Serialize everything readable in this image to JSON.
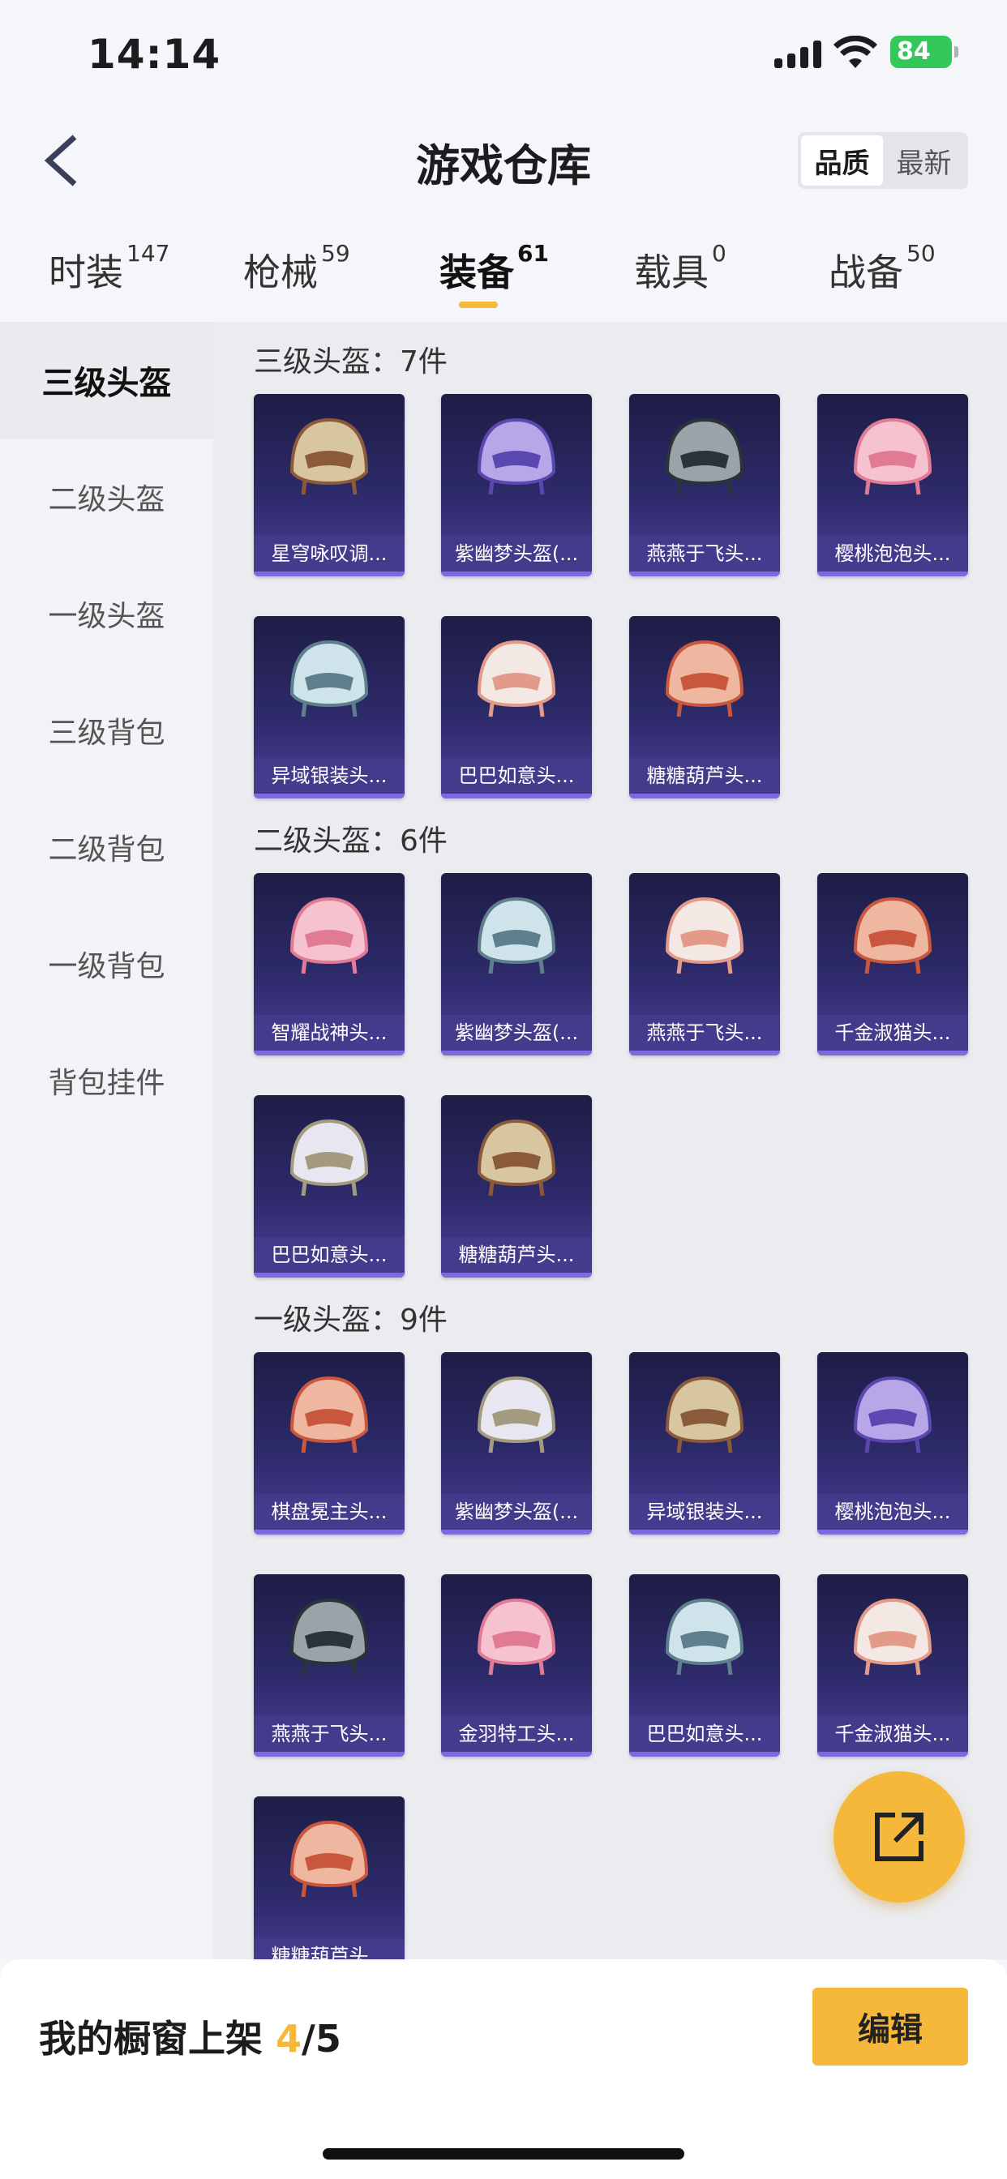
{
  "status": {
    "time": "14:14",
    "battery": "84"
  },
  "header": {
    "title": "游戏仓库",
    "sort_options": [
      "品质",
      "最新"
    ],
    "sort_active": 0
  },
  "tabs": [
    {
      "label": "时装",
      "count": "147"
    },
    {
      "label": "枪械",
      "count": "59"
    },
    {
      "label": "装备",
      "count": "61"
    },
    {
      "label": "载具",
      "count": "0"
    },
    {
      "label": "战备",
      "count": "50"
    }
  ],
  "sidebar": [
    "三级头盔",
    "二级头盔",
    "一级头盔",
    "三级背包",
    "二级背包",
    "一级背包",
    "背包挂件"
  ],
  "sections": [
    {
      "title": "三级头盔：7件",
      "items": [
        "星穹咏叹调...",
        "紫幽梦头盔(...",
        "燕燕于飞头...",
        "樱桃泡泡头...",
        "异域银装头...",
        "巴巴如意头...",
        "糖糖葫芦头..."
      ]
    },
    {
      "title": "二级头盔：6件",
      "items": [
        "智耀战神头...",
        "紫幽梦头盔(...",
        "燕燕于飞头...",
        "千金淑猫头...",
        "巴巴如意头...",
        "糖糖葫芦头..."
      ]
    },
    {
      "title": "一级头盔：9件",
      "items": [
        "棋盘冕主头...",
        "紫幽梦头盔(...",
        "异域银装头...",
        "樱桃泡泡头...",
        "燕燕于飞头...",
        "金羽特工头...",
        "巴巴如意头...",
        "千金淑猫头...",
        "糖糖葫芦头..."
      ]
    }
  ],
  "bottom": {
    "label": "我的橱窗上架",
    "current": "4",
    "total": "/5",
    "edit_label": "编辑"
  },
  "colors": {
    "accent": "#f5b83a",
    "card_bg": "#2d2a6a"
  }
}
